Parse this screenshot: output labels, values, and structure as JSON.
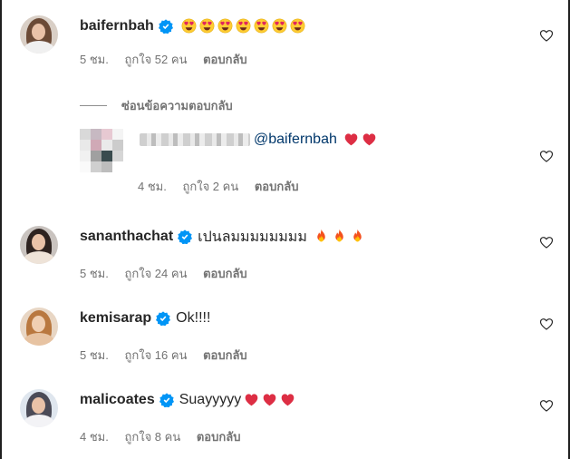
{
  "comments": [
    {
      "username": "baifernbah",
      "verified": true,
      "text": "",
      "emoji": [
        "heart-eyes",
        "heart-eyes",
        "heart-eyes",
        "heart-eyes",
        "heart-eyes",
        "heart-eyes",
        "heart-eyes"
      ],
      "time": "5 ชม.",
      "likes": "ถูกใจ 52 คน",
      "reply": "ตอบกลับ"
    },
    {
      "username": "sananthachat",
      "verified": true,
      "text": "เปนลมมมมมมมม",
      "emoji": [
        "fire",
        "fire",
        "fire"
      ],
      "time": "5 ชม.",
      "likes": "ถูกใจ 24 คน",
      "reply": "ตอบกลับ"
    },
    {
      "username": "kemisarap",
      "verified": true,
      "text": "Ok!!!!",
      "emoji": [],
      "time": "5 ชม.",
      "likes": "ถูกใจ 16 คน",
      "reply": "ตอบกลับ"
    },
    {
      "username": "malicoates",
      "verified": true,
      "text": "Suayyyyy",
      "emoji": [
        "red-heart",
        "red-heart",
        "red-heart"
      ],
      "time": "4 ชม.",
      "likes": "ถูกใจ 8 คน",
      "reply": "ตอบกลับ"
    }
  ],
  "hide_replies_label": "ซ่อนข้อความตอบกลับ",
  "reply_comment": {
    "mention": "@baifernbah",
    "emoji": [
      "red-heart",
      "red-heart"
    ],
    "time": "4 ชม.",
    "likes": "ถูกใจ 2 คน",
    "reply": "ตอบกลับ"
  },
  "colors": {
    "verified": "#0095f6",
    "meta": "#737373",
    "mention": "#00376b",
    "heart": "#e0245e"
  }
}
